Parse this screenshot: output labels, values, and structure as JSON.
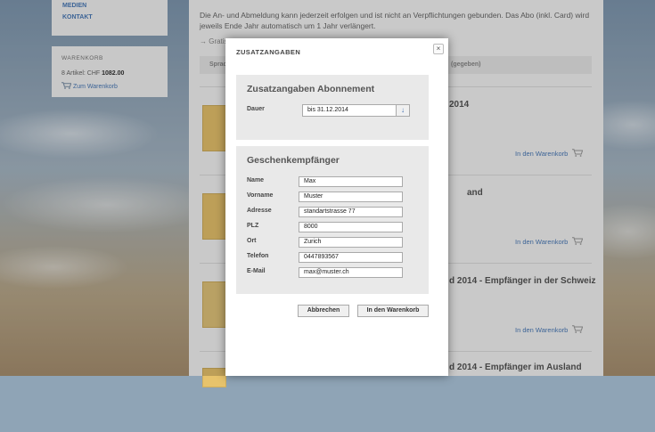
{
  "background": {
    "nav_links": [
      "MEDIEN",
      "KONTAKT"
    ],
    "cart": {
      "title": "WARENKORB",
      "count_text": "8 Artikel: CHF ",
      "amount": "1082.00",
      "link": "Zum Warenkorb"
    },
    "intro_text": "Die An- und Abmeldung kann jederzeit erfolgen und ist nicht an Verpflichtungen gebunden. Das Abo (inkl. Card) wird jeweils Ende Jahr automatisch um 1 Jahr verlängert.",
    "link_text": "→ Gratis",
    "table_headers": [
      "Sprac",
      "(gegeben)"
    ],
    "items": [
      {
        "title": "2014",
        "add": "In den Warenkorb"
      },
      {
        "title": "and",
        "add": "In den Warenkorb"
      },
      {
        "title": "d 2014 - Empfänger in der Schweiz",
        "add": "In den Warenkorb"
      },
      {
        "title": "d 2014 - Empfänger im Ausland",
        "add": ""
      }
    ]
  },
  "modal": {
    "title": "ZUSATZANGABEN",
    "close_glyph": "×",
    "subscription": {
      "heading": "Zusatzangaben Abonnement",
      "duration_label": "Dauer",
      "duration_value": "bis 31.12.2014",
      "arrow_glyph": "↓"
    },
    "recipient": {
      "heading": "Geschenkempfänger",
      "fields": [
        {
          "label": "Name",
          "value": "Max"
        },
        {
          "label": "Vorname",
          "value": "Muster"
        },
        {
          "label": "Adresse",
          "value": "standartstrasse 77"
        },
        {
          "label": "PLZ",
          "value": "8000"
        },
        {
          "label": "Ort",
          "value": "Zurich"
        },
        {
          "label": "Telefon",
          "value": "0447893567"
        },
        {
          "label": "E-Mail",
          "value": "max@muster.ch"
        }
      ]
    },
    "buttons": {
      "cancel": "Abbrechen",
      "add_to_cart": "In den Warenkorb"
    }
  }
}
